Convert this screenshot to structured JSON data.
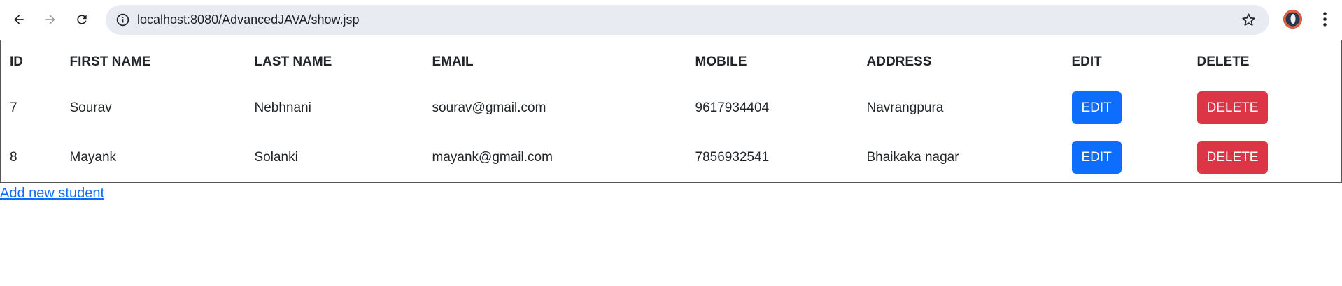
{
  "browser": {
    "url": "localhost:8080/AdvancedJAVA/show.jsp",
    "icons": {
      "back": "arrow-left-icon",
      "forward": "arrow-right-icon",
      "reload": "reload-icon",
      "site_info": "site-info-icon",
      "bookmark": "star-icon",
      "profile": "avatar",
      "menu": "kebab-menu-icon"
    }
  },
  "table": {
    "headers": {
      "id": "ID",
      "first_name": "FIRST NAME",
      "last_name": "LAST NAME",
      "email": "EMAIL",
      "mobile": "MOBILE",
      "address": "ADDRESS",
      "edit": "EDIT",
      "delete": "DELETE"
    },
    "rows": [
      {
        "id": "7",
        "first_name": "Sourav",
        "last_name": "Nebhnani",
        "email": "sourav@gmail.com",
        "mobile": "9617934404",
        "address": "Navrangpura",
        "edit_label": "EDIT",
        "delete_label": "DELETE"
      },
      {
        "id": "8",
        "first_name": "Mayank",
        "last_name": "Solanki",
        "email": "mayank@gmail.com",
        "mobile": "7856932541",
        "address": "Bhaikaka nagar",
        "edit_label": "EDIT",
        "delete_label": "DELETE"
      }
    ]
  },
  "add_link": "Add new student",
  "colors": {
    "primary": "#0d6efd",
    "danger": "#dc3545",
    "omnibox": "#e9ebf3"
  }
}
